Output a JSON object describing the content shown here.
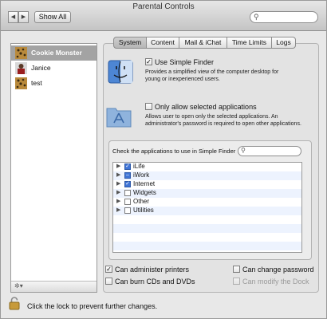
{
  "window": {
    "title": "Parental Controls"
  },
  "toolbar": {
    "back": "◀",
    "forward": "▶",
    "show_all": "Show All",
    "search_placeholder": ""
  },
  "sidebar": {
    "users": [
      {
        "name": "Cookie Monster",
        "selected": true
      },
      {
        "name": "Janice",
        "selected": false
      },
      {
        "name": "test",
        "selected": false
      }
    ],
    "gear_label": "✲▾"
  },
  "tabs": [
    {
      "label": "System",
      "active": true
    },
    {
      "label": "Content",
      "active": false
    },
    {
      "label": "Mail & iChat",
      "active": false
    },
    {
      "label": "Time Limits",
      "active": false
    },
    {
      "label": "Logs",
      "active": false
    }
  ],
  "system": {
    "simple_finder": {
      "label": "Use Simple Finder",
      "checked": true,
      "description": "Provides a simplified view of the computer desktop for young or inexperienced users."
    },
    "only_selected_apps": {
      "label": "Only allow selected applications",
      "checked": false,
      "description": "Allows user to open only the selected applications. An administrator's password is required to open other applications."
    },
    "apps_list": {
      "label": "Check the applications to use in Simple Finder",
      "search_placeholder": "",
      "items": [
        {
          "name": "iLife",
          "state": "checked"
        },
        {
          "name": "iWork",
          "state": "mixed"
        },
        {
          "name": "Internet",
          "state": "checked"
        },
        {
          "name": "Widgets",
          "state": "unchecked"
        },
        {
          "name": "Other",
          "state": "unchecked"
        },
        {
          "name": "Utilities",
          "state": "unchecked"
        }
      ]
    },
    "options": {
      "administer_printers": {
        "label": "Can administer printers",
        "checked": true
      },
      "change_password": {
        "label": "Can change password",
        "checked": false
      },
      "burn_cds": {
        "label": "Can burn CDs and DVDs",
        "checked": false
      },
      "modify_dock": {
        "label": "Can modify the Dock",
        "checked": false,
        "disabled": true
      }
    }
  },
  "footer": {
    "lock_text": "Click the lock to prevent further changes."
  },
  "icons": {
    "back": "chevron-left-icon",
    "forward": "chevron-right-icon",
    "search": "search-icon",
    "finder": "finder-icon",
    "applications": "applications-folder-icon",
    "lock": "lock-icon",
    "gear": "gear-icon"
  },
  "colors": {
    "selection": "#a3a3a3",
    "checkbox_on": "#3f74d6",
    "row_alt": "#edf3fe"
  }
}
